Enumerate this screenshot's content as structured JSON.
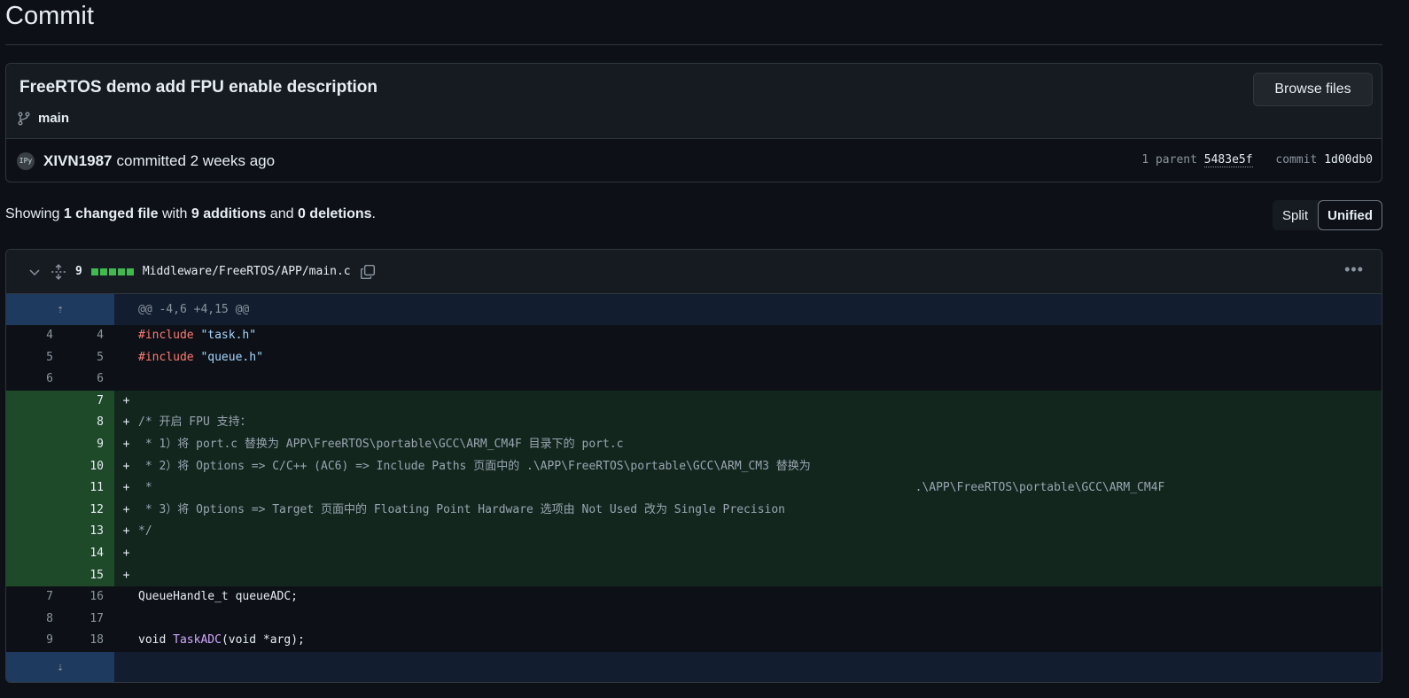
{
  "page_title": "Commit",
  "commit": {
    "message": "FreeRTOS demo add FPU enable description",
    "branch": "main",
    "browse_label": "Browse files",
    "avatar_text": "IPy",
    "author": "XIVN1987",
    "committed_text": "committed 2 weeks ago",
    "parent_label": "1 parent",
    "parent_sha": "5483e5f",
    "commit_label": "commit",
    "commit_sha": "1d00db0"
  },
  "summary": {
    "showing": "Showing",
    "changed": "1 changed file",
    "with": "with",
    "additions": "9 additions",
    "and": "and",
    "deletions": "0 deletions",
    "end": "."
  },
  "view_toggle": {
    "split": "Split",
    "unified": "Unified",
    "selected": "Unified"
  },
  "file": {
    "change_count": "9",
    "path": "Middleware/FreeRTOS/APP/main.c",
    "hunk_header": "@@ -4,6 +4,15 @@",
    "lines": [
      {
        "type": "ctx",
        "old": "4",
        "new": "4",
        "tokens": [
          {
            "c": "kw",
            "t": "#include"
          },
          {
            "c": "",
            "t": " "
          },
          {
            "c": "str",
            "t": "\"task.h\""
          }
        ]
      },
      {
        "type": "ctx",
        "old": "5",
        "new": "5",
        "tokens": [
          {
            "c": "kw",
            "t": "#include"
          },
          {
            "c": "",
            "t": " "
          },
          {
            "c": "str",
            "t": "\"queue.h\""
          }
        ]
      },
      {
        "type": "ctx",
        "old": "6",
        "new": "6",
        "tokens": []
      },
      {
        "type": "add",
        "old": "",
        "new": "7",
        "tokens": []
      },
      {
        "type": "add",
        "old": "",
        "new": "8",
        "tokens": [
          {
            "c": "comment",
            "t": "/* 开启 FPU 支持："
          }
        ]
      },
      {
        "type": "add",
        "old": "",
        "new": "9",
        "tokens": [
          {
            "c": "comment",
            "t": " * 1）将 port.c 替换为 APP\\FreeRTOS\\portable\\GCC\\ARM_CM4F 目录下的 port.c"
          }
        ]
      },
      {
        "type": "add",
        "old": "",
        "new": "10",
        "tokens": [
          {
            "c": "comment",
            "t": " * 2）将 Options => C/C++ (AC6) => Include Paths 页面中的 .\\APP\\FreeRTOS\\portable\\GCC\\ARM_CM3 替换为"
          }
        ]
      },
      {
        "type": "add",
        "old": "",
        "new": "11",
        "tokens": [
          {
            "c": "comment",
            "t": " *                                                                                                              .\\APP\\FreeRTOS\\portable\\GCC\\ARM_CM4F"
          }
        ]
      },
      {
        "type": "add",
        "old": "",
        "new": "12",
        "tokens": [
          {
            "c": "comment",
            "t": " * 3）将 Options => Target 页面中的 Floating Point Hardware 选项由 Not Used 改为 Single Precision"
          }
        ]
      },
      {
        "type": "add",
        "old": "",
        "new": "13",
        "tokens": [
          {
            "c": "comment",
            "t": "*/"
          }
        ]
      },
      {
        "type": "add",
        "old": "",
        "new": "14",
        "tokens": []
      },
      {
        "type": "add",
        "old": "",
        "new": "15",
        "tokens": []
      },
      {
        "type": "ctx",
        "old": "7",
        "new": "16",
        "tokens": [
          {
            "c": "",
            "t": "QueueHandle_t queueADC;"
          }
        ]
      },
      {
        "type": "ctx",
        "old": "8",
        "new": "17",
        "tokens": []
      },
      {
        "type": "ctx",
        "old": "9",
        "new": "18",
        "tokens": [
          {
            "c": "",
            "t": "void "
          },
          {
            "c": "fn",
            "t": "TaskADC"
          },
          {
            "c": "",
            "t": "(void *arg);"
          }
        ]
      }
    ]
  },
  "colors": {
    "addition": "#3fb950",
    "add_bg": "#12261e",
    "hunk_bg": "#121d2f",
    "keyword": "#ff7b72",
    "string": "#a5d6ff",
    "function": "#d2a8ff"
  }
}
